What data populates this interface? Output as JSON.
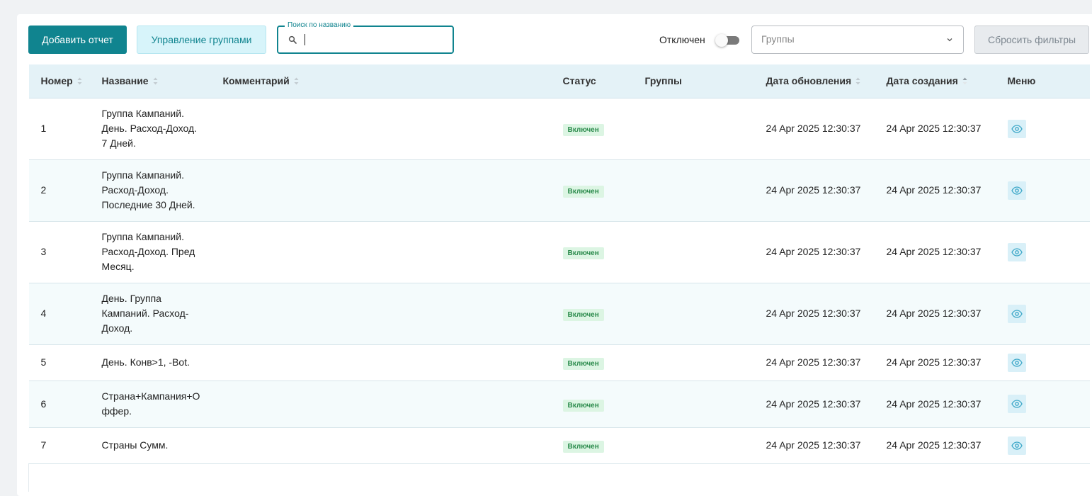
{
  "toolbar": {
    "add_report_label": "Добавить отчет",
    "manage_groups_label": "Управление группами",
    "search": {
      "legend": "Поиск по названию",
      "value": "",
      "placeholder": ""
    },
    "toggle_label": "Отключен",
    "toggle_on": false,
    "groups_select_placeholder": "Группы",
    "reset_filters_label": "Сбросить фильтры"
  },
  "table": {
    "columns": {
      "number": "Номер",
      "name": "Название",
      "comment": "Комментарий",
      "status": "Статус",
      "groups": "Группы",
      "updated": "Дата обновления",
      "created": "Дата создания",
      "menu": "Меню"
    },
    "rows": [
      {
        "number": "1",
        "name": "Группа Кампаний. День. Расход-Доход. 7 Дней.",
        "comment": "",
        "status": "Включен",
        "groups": "",
        "updated": "24 Apr 2025 12:30:37",
        "created": "24 Apr 2025 12:30:37"
      },
      {
        "number": "2",
        "name": "Группа Кампаний. Расход-Доход. Последние 30 Дней.",
        "comment": "",
        "status": "Включен",
        "groups": "",
        "updated": "24 Apr 2025 12:30:37",
        "created": "24 Apr 2025 12:30:37"
      },
      {
        "number": "3",
        "name": "Группа Кампаний. Расход-Доход. Пред Месяц.",
        "comment": "",
        "status": "Включен",
        "groups": "",
        "updated": "24 Apr 2025 12:30:37",
        "created": "24 Apr 2025 12:30:37"
      },
      {
        "number": "4",
        "name": "День. Группа Кампаний. Расход-Доход.",
        "comment": "",
        "status": "Включен",
        "groups": "",
        "updated": "24 Apr 2025 12:30:37",
        "created": "24 Apr 2025 12:30:37"
      },
      {
        "number": "5",
        "name": "День. Конв>1, -Bot.",
        "comment": "",
        "status": "Включен",
        "groups": "",
        "updated": "24 Apr 2025 12:30:37",
        "created": "24 Apr 2025 12:30:37"
      },
      {
        "number": "6",
        "name": "Страна+Кампания+Оффер.",
        "comment": "",
        "status": "Включен",
        "groups": "",
        "updated": "24 Apr 2025 12:30:37",
        "created": "24 Apr 2025 12:30:37"
      },
      {
        "number": "7",
        "name": "Страны Сумм.",
        "comment": "",
        "status": "Включен",
        "groups": "",
        "updated": "24 Apr 2025 12:30:37",
        "created": "24 Apr 2025 12:30:37"
      }
    ]
  },
  "icons": {
    "search": "search-icon",
    "chevron": "chevron-down-icon",
    "sort": "sort-icon",
    "view": "eye-icon"
  },
  "colors": {
    "accent": "#10848f",
    "header_bg": "#e4f2f7",
    "status_badge_bg": "#dcf5e3",
    "status_badge_text": "#2a8a4b"
  }
}
